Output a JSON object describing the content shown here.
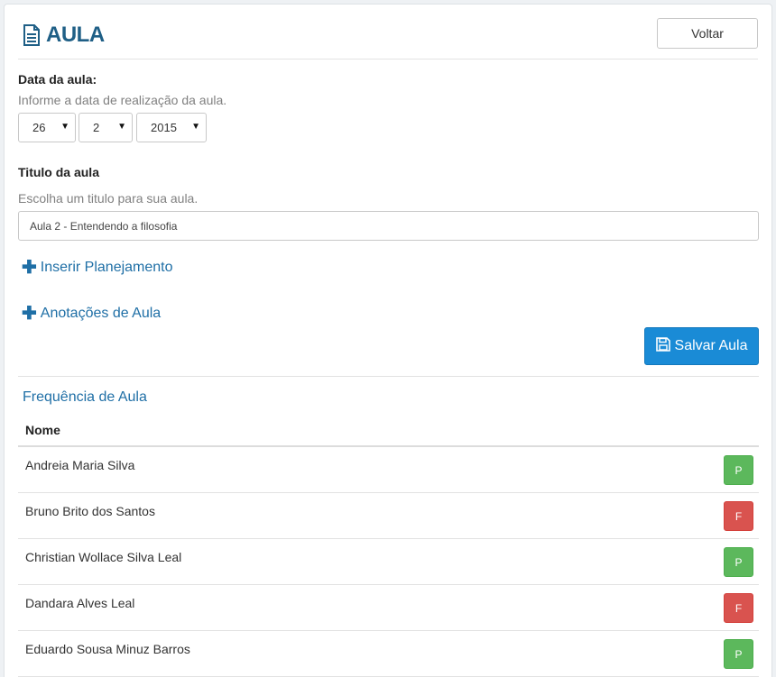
{
  "header": {
    "title": "AULA",
    "back_label": "Voltar"
  },
  "date_section": {
    "label": "Data da aula:",
    "help": "Informe a data de realização da aula.",
    "day": "26",
    "month": "2",
    "year": "2015"
  },
  "title_section": {
    "label": "Titulo da aula",
    "help": "Escolha um titulo para sua aula.",
    "value": "Aula 2 - Entendendo a filosofia"
  },
  "links": {
    "planning": "Inserir Planejamento",
    "notes": "Anotações de Aula"
  },
  "save_label": "Salvar Aula",
  "attendance": {
    "title": "Frequência de Aula",
    "column_name": "Nome",
    "students": [
      {
        "name": "Andreia Maria Silva",
        "status": "P"
      },
      {
        "name": "Bruno Brito dos Santos",
        "status": "F"
      },
      {
        "name": "Christian Wollace Silva Leal",
        "status": "P"
      },
      {
        "name": "Dandara Alves Leal",
        "status": "F"
      },
      {
        "name": "Eduardo Sousa Minuz Barros",
        "status": "P"
      }
    ]
  },
  "colors": {
    "accent": "#1a8bd6",
    "title": "#1f5f86",
    "present": "#5cb85c",
    "absent": "#d9534f"
  },
  "icons": {
    "title": "document-icon",
    "select_caret": "caret-down-icon",
    "links": "plus-icon",
    "save": "floppy-disk-icon"
  }
}
